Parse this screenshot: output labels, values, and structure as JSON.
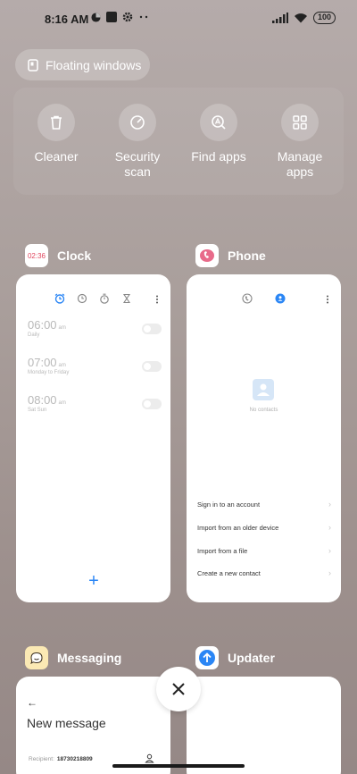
{
  "status_bar": {
    "time": "8:16 AM",
    "battery": "100"
  },
  "floating_windows": {
    "label": "Floating windows"
  },
  "quick_actions": [
    {
      "label": "Cleaner",
      "icon": "trash-icon"
    },
    {
      "label": "Security\nscan",
      "icon": "security-scan-icon"
    },
    {
      "label": "Find apps",
      "icon": "find-apps-icon"
    },
    {
      "label": "Manage\napps",
      "icon": "grid-icon"
    }
  ],
  "apps": {
    "clock": {
      "name": "Clock",
      "icon_text": "02:36",
      "alarms": [
        {
          "time": "06:00",
          "ampm": "am",
          "sub": "Daily"
        },
        {
          "time": "07:00",
          "ampm": "am",
          "sub": "Monday to Friday"
        },
        {
          "time": "08:00",
          "ampm": "am",
          "sub": "Sat Sun"
        }
      ],
      "add": "+"
    },
    "phone": {
      "name": "Phone",
      "empty_text": "No contacts",
      "items": [
        "Sign in to an account",
        "Import from an older device",
        "Import from a file",
        "Create a new contact"
      ]
    },
    "messaging": {
      "name": "Messaging",
      "title": "New message",
      "recipient_label": "Recipient:",
      "recipient_value": "18730218809"
    },
    "updater": {
      "name": "Updater"
    }
  },
  "colors": {
    "accent": "#2b86f5"
  }
}
